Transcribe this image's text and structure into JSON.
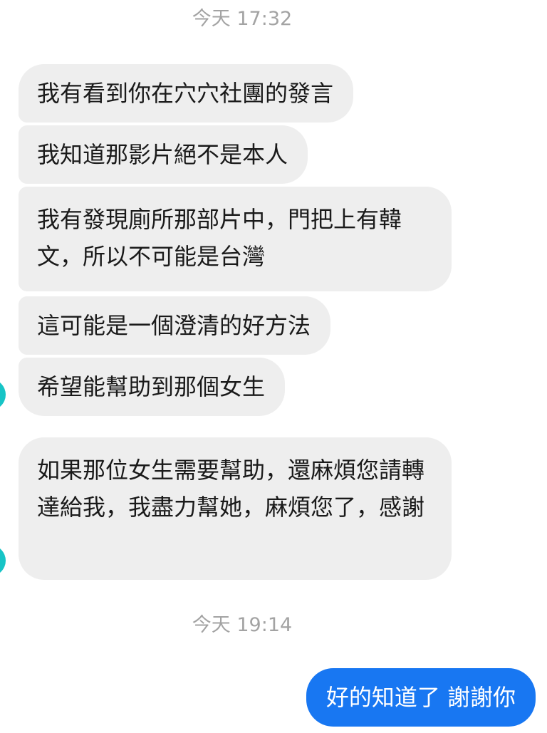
{
  "conversation": {
    "timestamps": [
      "今天 17:32",
      "今天 19:14"
    ],
    "incoming": [
      "我有看到你在穴穴社團的發言",
      "我知道那影片絕不是本人",
      "我有發現廁所那部片中，門把上有韓文，所以不可能是台灣",
      "這可能是一個澄清的好方法",
      "希望能幫助到那個女生",
      "如果那位女生需要幫助，還麻煩您請轉達給我，我盡力幫她，麻煩您了，感謝"
    ],
    "outgoing": [
      "好的知道了 謝謝你"
    ]
  },
  "colors": {
    "incoming_bubble": "#eeeeee",
    "outgoing_bubble": "#1877f2",
    "timestamp_text": "#a3a3a3",
    "avatar": "#17c4c6"
  }
}
